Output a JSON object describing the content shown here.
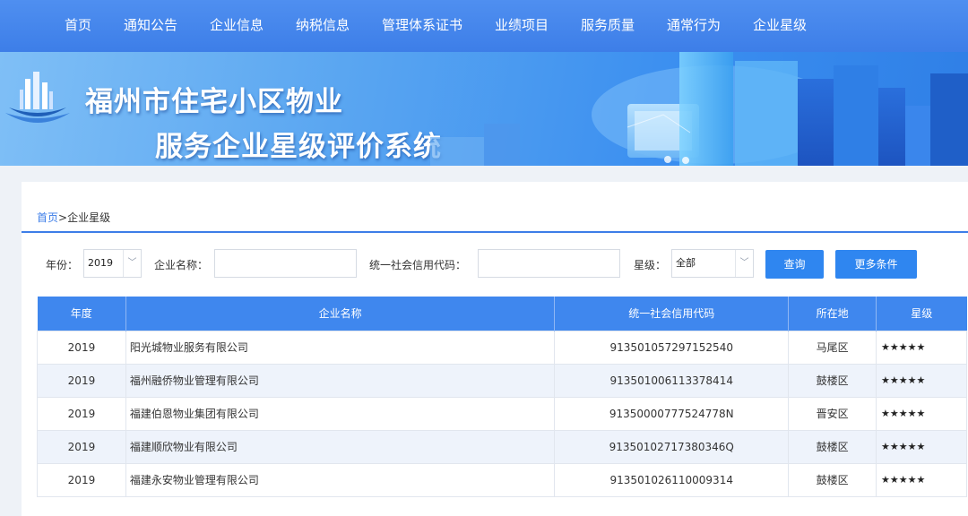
{
  "nav": {
    "items": [
      "首页",
      "通知公告",
      "企业信息",
      "纳税信息",
      "管理体系证书",
      "业绩项目",
      "服务质量",
      "通常行为",
      "企业星级"
    ]
  },
  "banner": {
    "title_line1": "福州市住宅小区物业",
    "title_line2": "服务企业星级评价系统"
  },
  "breadcrumb": {
    "home": "首页",
    "separator": ">",
    "current": "企业星级"
  },
  "filters": {
    "year_label": "年份：",
    "year_value": "2019",
    "company_label": "企业名称：",
    "company_value": "",
    "credit_label": "统一社会信用代码：",
    "credit_value": "",
    "star_label": "星级：",
    "star_value": "全部",
    "query_button": "查询",
    "more_button": "更多条件"
  },
  "table": {
    "headers": [
      "年度",
      "企业名称",
      "统一社会信用代码",
      "所在地",
      "星级"
    ],
    "rows": [
      {
        "year": "2019",
        "name": "阳光城物业服务有限公司",
        "code": "913501057297152540",
        "location": "马尾区",
        "stars": "★★★★★"
      },
      {
        "year": "2019",
        "name": "福州融侨物业管理有限公司",
        "code": "913501006113378414",
        "location": "鼓楼区",
        "stars": "★★★★★"
      },
      {
        "year": "2019",
        "name": "福建伯恩物业集团有限公司",
        "code": "91350000777524778N",
        "location": "晋安区",
        "stars": "★★★★★"
      },
      {
        "year": "2019",
        "name": "福建顺欣物业有限公司",
        "code": "91350102717380346Q",
        "location": "鼓楼区",
        "stars": "★★★★★"
      },
      {
        "year": "2019",
        "name": "福建永安物业管理有限公司",
        "code": "913501026110009314",
        "location": "鼓楼区",
        "stars": "★★★★★"
      }
    ]
  },
  "colors": {
    "nav_bg": "#3d7ee8",
    "accent": "#2f86f0",
    "table_header": "#3f87ee",
    "row_alt": "#eef3fb"
  }
}
